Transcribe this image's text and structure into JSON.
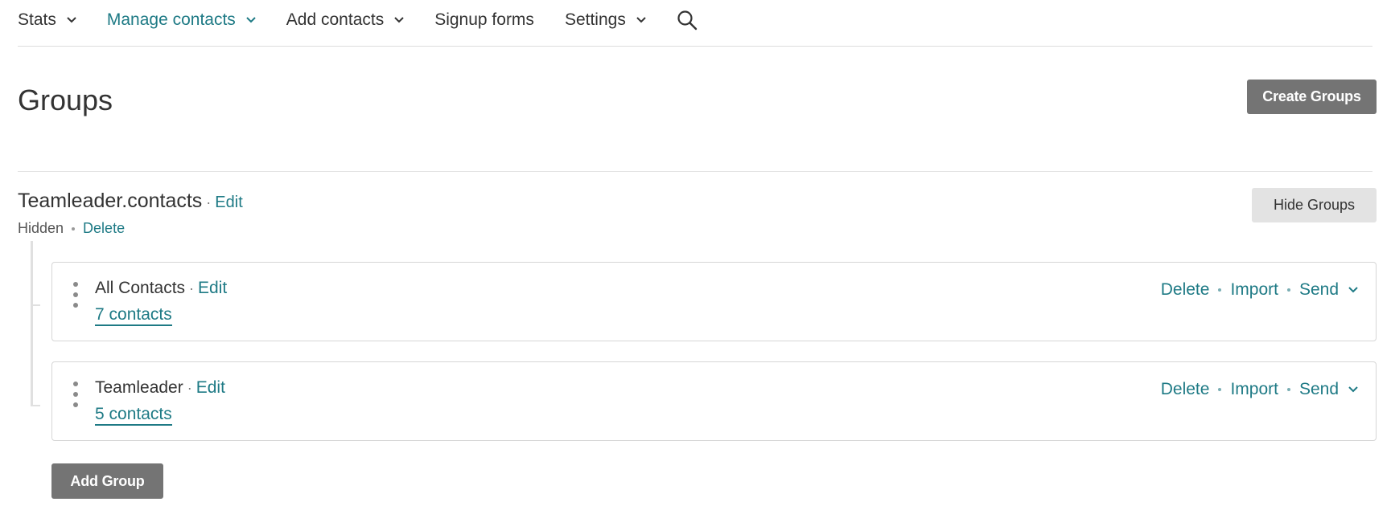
{
  "nav": {
    "items": [
      {
        "label": "Stats",
        "has_dropdown": true,
        "active": false
      },
      {
        "label": "Manage contacts",
        "has_dropdown": true,
        "active": true
      },
      {
        "label": "Add contacts",
        "has_dropdown": true,
        "active": false
      },
      {
        "label": "Signup forms",
        "has_dropdown": false,
        "active": false
      },
      {
        "label": "Settings",
        "has_dropdown": true,
        "active": false
      }
    ],
    "search_icon": "search-icon"
  },
  "header": {
    "title": "Groups",
    "create_button": "Create Groups"
  },
  "category": {
    "name": "Teamleader.contacts",
    "edit_label": "Edit",
    "status": "Hidden",
    "delete_label": "Delete",
    "hide_button": "Hide Groups"
  },
  "groups": [
    {
      "name": "All Contacts",
      "edit_label": "Edit",
      "count_label": "7 contacts",
      "actions": {
        "delete": "Delete",
        "import": "Import",
        "send": "Send"
      }
    },
    {
      "name": "Teamleader",
      "edit_label": "Edit",
      "count_label": "5 contacts",
      "actions": {
        "delete": "Delete",
        "import": "Import",
        "send": "Send"
      }
    }
  ],
  "footer": {
    "add_group_button": "Add Group"
  },
  "colors": {
    "accent": "#1e7a85",
    "button_dark": "#747474",
    "button_light": "#e3e3e3",
    "text": "#333333"
  }
}
